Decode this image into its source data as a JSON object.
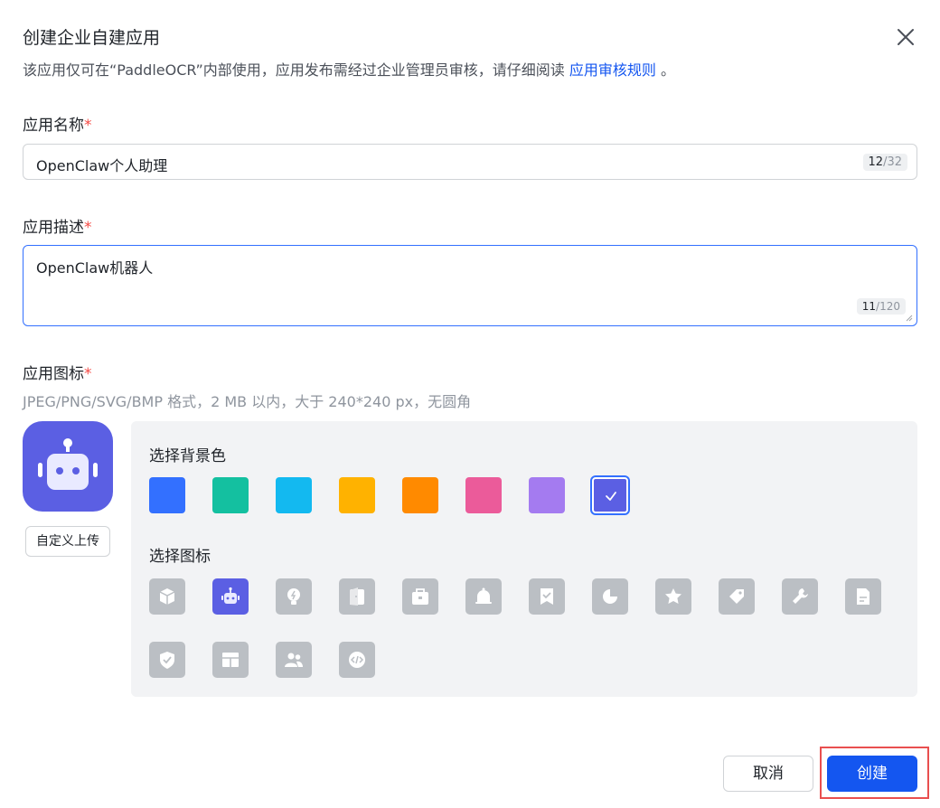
{
  "dialog": {
    "title": "创建企业自建应用",
    "subtitle_prefix": "该应用仅可在“PaddleOCR”内部使用，应用发布需经过企业管理员审核，请仔细阅读 ",
    "subtitle_link": "应用审核规则",
    "subtitle_suffix": " 。"
  },
  "name_field": {
    "label": "应用名称",
    "required_mark": "*",
    "value": "OpenClaw个人助理",
    "count_current": "12",
    "count_max": "/32"
  },
  "desc_field": {
    "label": "应用描述",
    "required_mark": "*",
    "value": "OpenClaw机器人",
    "count_current": "11",
    "count_max": "/120"
  },
  "icon_field": {
    "label": "应用图标",
    "required_mark": "*",
    "hint": "JPEG/PNG/SVG/BMP 格式，2 MB 以内，大于 240*240 px，无圆角",
    "upload_label": "自定义上传"
  },
  "panel": {
    "bg_label": "选择背景色",
    "icon_label": "选择图标",
    "colors": [
      "#3370ff",
      "#14c0a0",
      "#13b9f0",
      "#ffb200",
      "#ff8a00",
      "#eb5b9a",
      "#a47bf0",
      "#5b5fe3"
    ],
    "selected_color": "#5b5fe3",
    "icons": [
      "cube-icon",
      "robot-icon",
      "lightbulb-icon",
      "door-icon",
      "briefcase-icon",
      "bell-icon",
      "bookmark-check-icon",
      "pie-chart-icon",
      "star-icon",
      "tag-icon",
      "wrench-icon",
      "document-icon",
      "shield-check-icon",
      "layout-icon",
      "users-icon",
      "code-icon"
    ],
    "selected_icon": "robot-icon"
  },
  "footer": {
    "cancel_label": "取消",
    "create_label": "创建"
  }
}
